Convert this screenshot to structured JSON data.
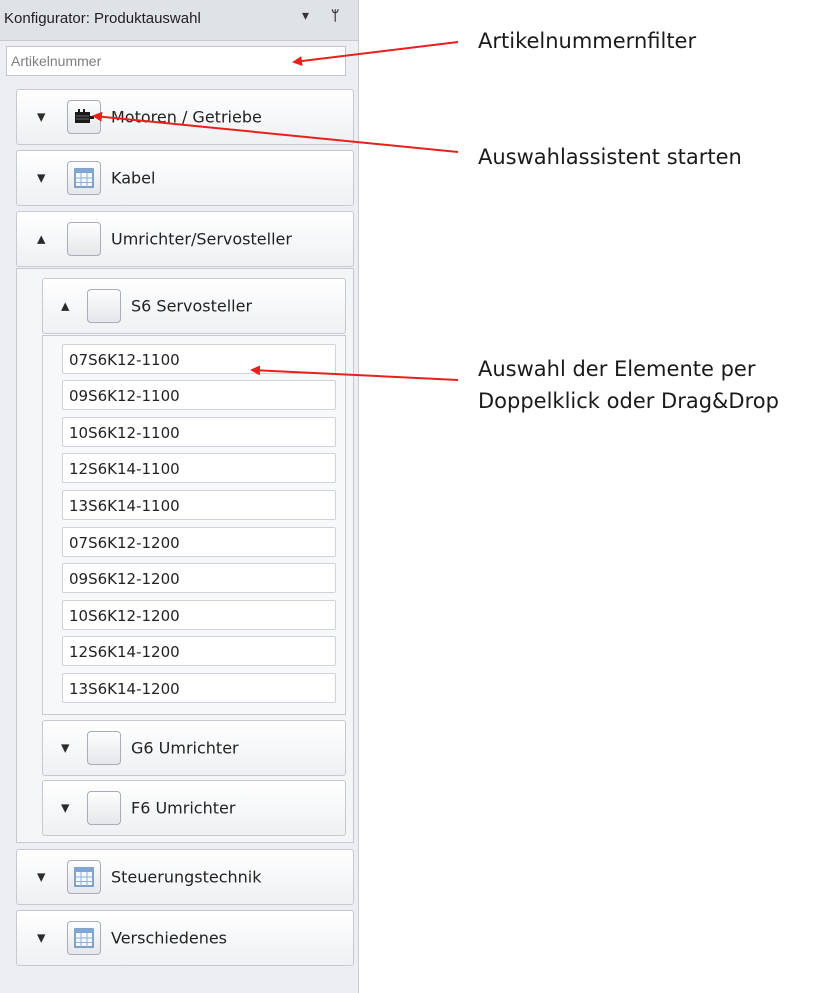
{
  "panel": {
    "title": "Konfigurator: Produktauswahl",
    "dropdown_icon": "triangle-down-icon",
    "pin_icon": "pin-icon",
    "filter": {
      "placeholder": "Artikelnummer",
      "value": ""
    }
  },
  "groups": [
    {
      "label": "Motoren / Getriebe",
      "icon": "motor-icon",
      "state": "collapsed"
    },
    {
      "label": "Kabel",
      "icon": "table-icon",
      "state": "collapsed"
    },
    {
      "label": "Umrichter/Servosteller",
      "icon": "blank-icon",
      "state": "expanded"
    },
    {
      "label": "Steuerungstechnik",
      "icon": "table-icon",
      "state": "collapsed"
    },
    {
      "label": "Verschiedenes",
      "icon": "table-icon",
      "state": "collapsed"
    }
  ],
  "subgroups": [
    {
      "label": "S6 Servosteller",
      "state": "expanded"
    },
    {
      "label": "G6 Umrichter",
      "state": "collapsed"
    },
    {
      "label": "F6 Umrichter",
      "state": "collapsed"
    }
  ],
  "s6_items": [
    "07S6K12-1100",
    "09S6K12-1100",
    "10S6K12-1100",
    "12S6K14-1100",
    "13S6K14-1100",
    "07S6K12-1200",
    "09S6K12-1200",
    "10S6K12-1200",
    "12S6K14-1200",
    "13S6K14-1200"
  ],
  "annotations": {
    "filter": "Artikelnummernfilter",
    "wizard": "Auswahlassistent starten",
    "selection_line1": "Auswahl der Elemente per",
    "selection_line2": "Doppelklick oder Drag&Drop",
    "arrow_color": "#e8201b"
  }
}
